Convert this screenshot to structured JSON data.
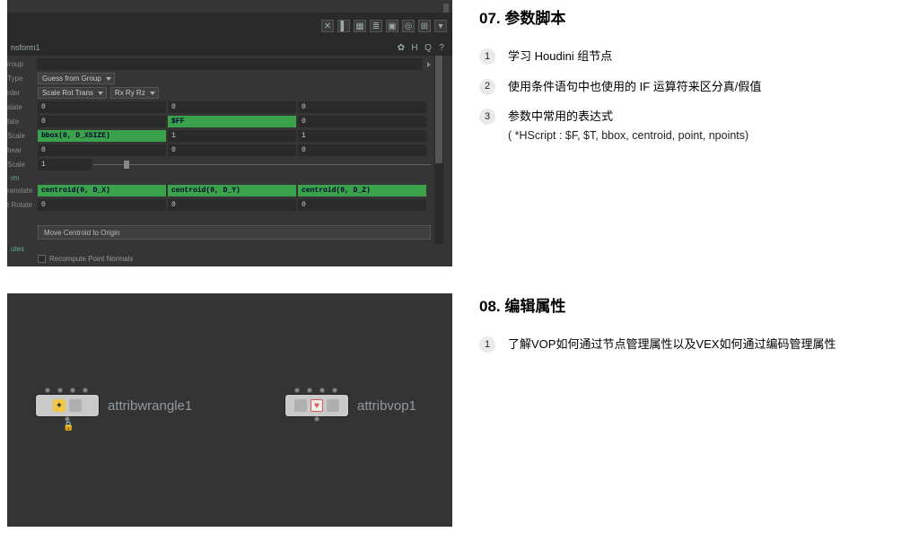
{
  "section07": {
    "title": "07. 参数脚本",
    "objectives": [
      {
        "n": "1",
        "text": "学习 Houdini 组节点"
      },
      {
        "n": "2",
        "text": "使用条件语句中也使用的 IF 运算符来区分真/假值"
      },
      {
        "n": "3",
        "text": "参数中常用的表达式",
        "sub": "( *HScript : $F, $T, bbox, centroid, point, npoints)"
      }
    ],
    "panel": {
      "node_name": "nsform1",
      "rows": {
        "group_label": "iroup",
        "type_label": "Type",
        "type_value": "Guess from Group",
        "order_label": "rder",
        "order_value1": "Scale Rot Trans",
        "order_value2": "Rx Ry Rz",
        "slate_label": "slate",
        "slate_v": [
          "0",
          "0",
          "0"
        ],
        "tate_label": "tate",
        "tate_v": [
          "0",
          "$FF",
          "0"
        ],
        "scale_label": "Scale",
        "scale_v": [
          "bbox(0, D_XSIZE)",
          "1",
          "1"
        ],
        "hear_label": "hear",
        "hear_v": [
          "0",
          "0",
          "0"
        ],
        "scale2_label": "Scale",
        "scale2_v": "1",
        "rm_label": "rm",
        "ranslate_label": "ranslate",
        "ranslate_v": [
          "centroid(0, D_X)",
          "centroid(0, D_Y)",
          "centroid(0, D_Z)"
        ],
        "trotate_label": "t Rotate",
        "trotate_v": [
          "0",
          "0",
          "0"
        ],
        "button": "Move Centroid to Origin",
        "utes_label": "utes",
        "check": "Recompute Point Normals"
      }
    }
  },
  "section08": {
    "title": "08. 编辑属性",
    "objectives": [
      {
        "n": "1",
        "text": "了解VOP如何通过节点管理属性以及VEX如何通过编码管理属性"
      }
    ],
    "nodes": {
      "n1_label": "attribwrangle1",
      "n2_label": "attribvop1"
    }
  }
}
